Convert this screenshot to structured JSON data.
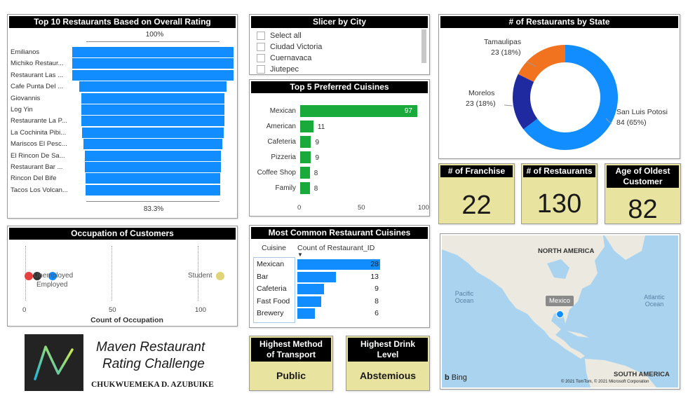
{
  "top10": {
    "title": "Top 10 Restaurants Based on Overall Rating",
    "top_pct": "100%",
    "bottom_pct": "83.3%",
    "items": [
      {
        "name": "Emilianos",
        "value": 100
      },
      {
        "name": "Michiko Restaur...",
        "value": 100
      },
      {
        "name": "Restaurant Las ...",
        "value": 100
      },
      {
        "name": "Cafe Punta Del ...",
        "value": 91.7
      },
      {
        "name": "Giovannis",
        "value": 88.9
      },
      {
        "name": "Log Yin",
        "value": 88.9
      },
      {
        "name": "Restaurante La P...",
        "value": 88.9
      },
      {
        "name": "La Cochinita Pibi...",
        "value": 87.5
      },
      {
        "name": "Mariscos El Pesc...",
        "value": 86.1
      },
      {
        "name": "El Rincon De Sa...",
        "value": 84.7
      },
      {
        "name": "Restaurant Bar ...",
        "value": 84.7
      },
      {
        "name": "Rincon Del Bife",
        "value": 83.3
      },
      {
        "name": "Tacos Los Volcan...",
        "value": 83.3
      }
    ]
  },
  "slicer": {
    "title": "Slicer by City",
    "items": [
      "Select all",
      "Ciudad Victoria",
      "Cuernavaca",
      "Jiutepec"
    ]
  },
  "cuisines": {
    "title": "Top 5 Preferred Cuisines",
    "categories": [
      "Mexican",
      "American",
      "Cafeteria",
      "Pizzeria",
      "Coffee Shop",
      "Family"
    ],
    "values": [
      97,
      11,
      9,
      9,
      8,
      8
    ],
    "ticks": [
      "0",
      "50",
      "100"
    ],
    "xlim": [
      0,
      100
    ]
  },
  "state": {
    "title": "# of Restaurants by State",
    "slices": [
      {
        "name": "San Luis Potosi",
        "label": "84 (65%)",
        "value": 84,
        "color": "#118dff"
      },
      {
        "name": "Morelos",
        "label": "23 (18%)",
        "value": 23,
        "color": "#1f2aa1"
      },
      {
        "name": "Tamaulipas",
        "label": "23 (18%)",
        "value": 23,
        "color": "#f2731f"
      }
    ]
  },
  "kpis": {
    "franchise_label": "# of Franchise",
    "franchise_value": "22",
    "restaurants_label": "# of Restaurants",
    "restaurants_value": "130",
    "oldest_label": "Age of Oldest Customer",
    "oldest_value": "82"
  },
  "occupation": {
    "title": "Occupation of Customers",
    "xlabel": "Count of Occupation",
    "ticks": [
      "0",
      "50",
      "100"
    ],
    "xlim": [
      0,
      100
    ],
    "points": [
      {
        "name": "Unemployed",
        "value": 2,
        "color": "#e8403f"
      },
      {
        "name": "",
        "value": 7,
        "color": "#333333"
      },
      {
        "name": "Employed",
        "value": 16,
        "color": "#118dff"
      },
      {
        "name": "Student",
        "value": 113,
        "color": "#e0d47a"
      }
    ]
  },
  "common": {
    "title": "Most Common Restaurant Cuisines",
    "col1": "Cuisine",
    "col2": "Count of Restaurant_ID",
    "rows": [
      {
        "name": "Mexican",
        "value": 28
      },
      {
        "name": "Bar",
        "value": 13
      },
      {
        "name": "Cafeteria",
        "value": 9
      },
      {
        "name": "Fast Food",
        "value": 8
      },
      {
        "name": "Brewery",
        "value": 6
      }
    ],
    "max": 28
  },
  "branding": {
    "title1": "Maven Restaurant",
    "title2": "Rating Challenge",
    "author": "CHUKWUEMEKA D. AZUBUIKE"
  },
  "transport": {
    "label": "Highest Method of Transport",
    "value": "Public"
  },
  "drink": {
    "label": "Highest Drink Level",
    "value": "Abstemious"
  },
  "map": {
    "north_america": "NORTH AMERICA",
    "south_america": "SOUTH AMERICA",
    "pacific": "Pacific Ocean",
    "atlantic": "Atlantic Ocean",
    "marker_label": "Mexico",
    "bing": "Bing",
    "copyright": "© 2021 TomTom, © 2021 Microsoft Corporation"
  },
  "colors": {
    "accent": "#118dff",
    "green": "#1aaa3c",
    "kpi": "#e8e39f"
  }
}
